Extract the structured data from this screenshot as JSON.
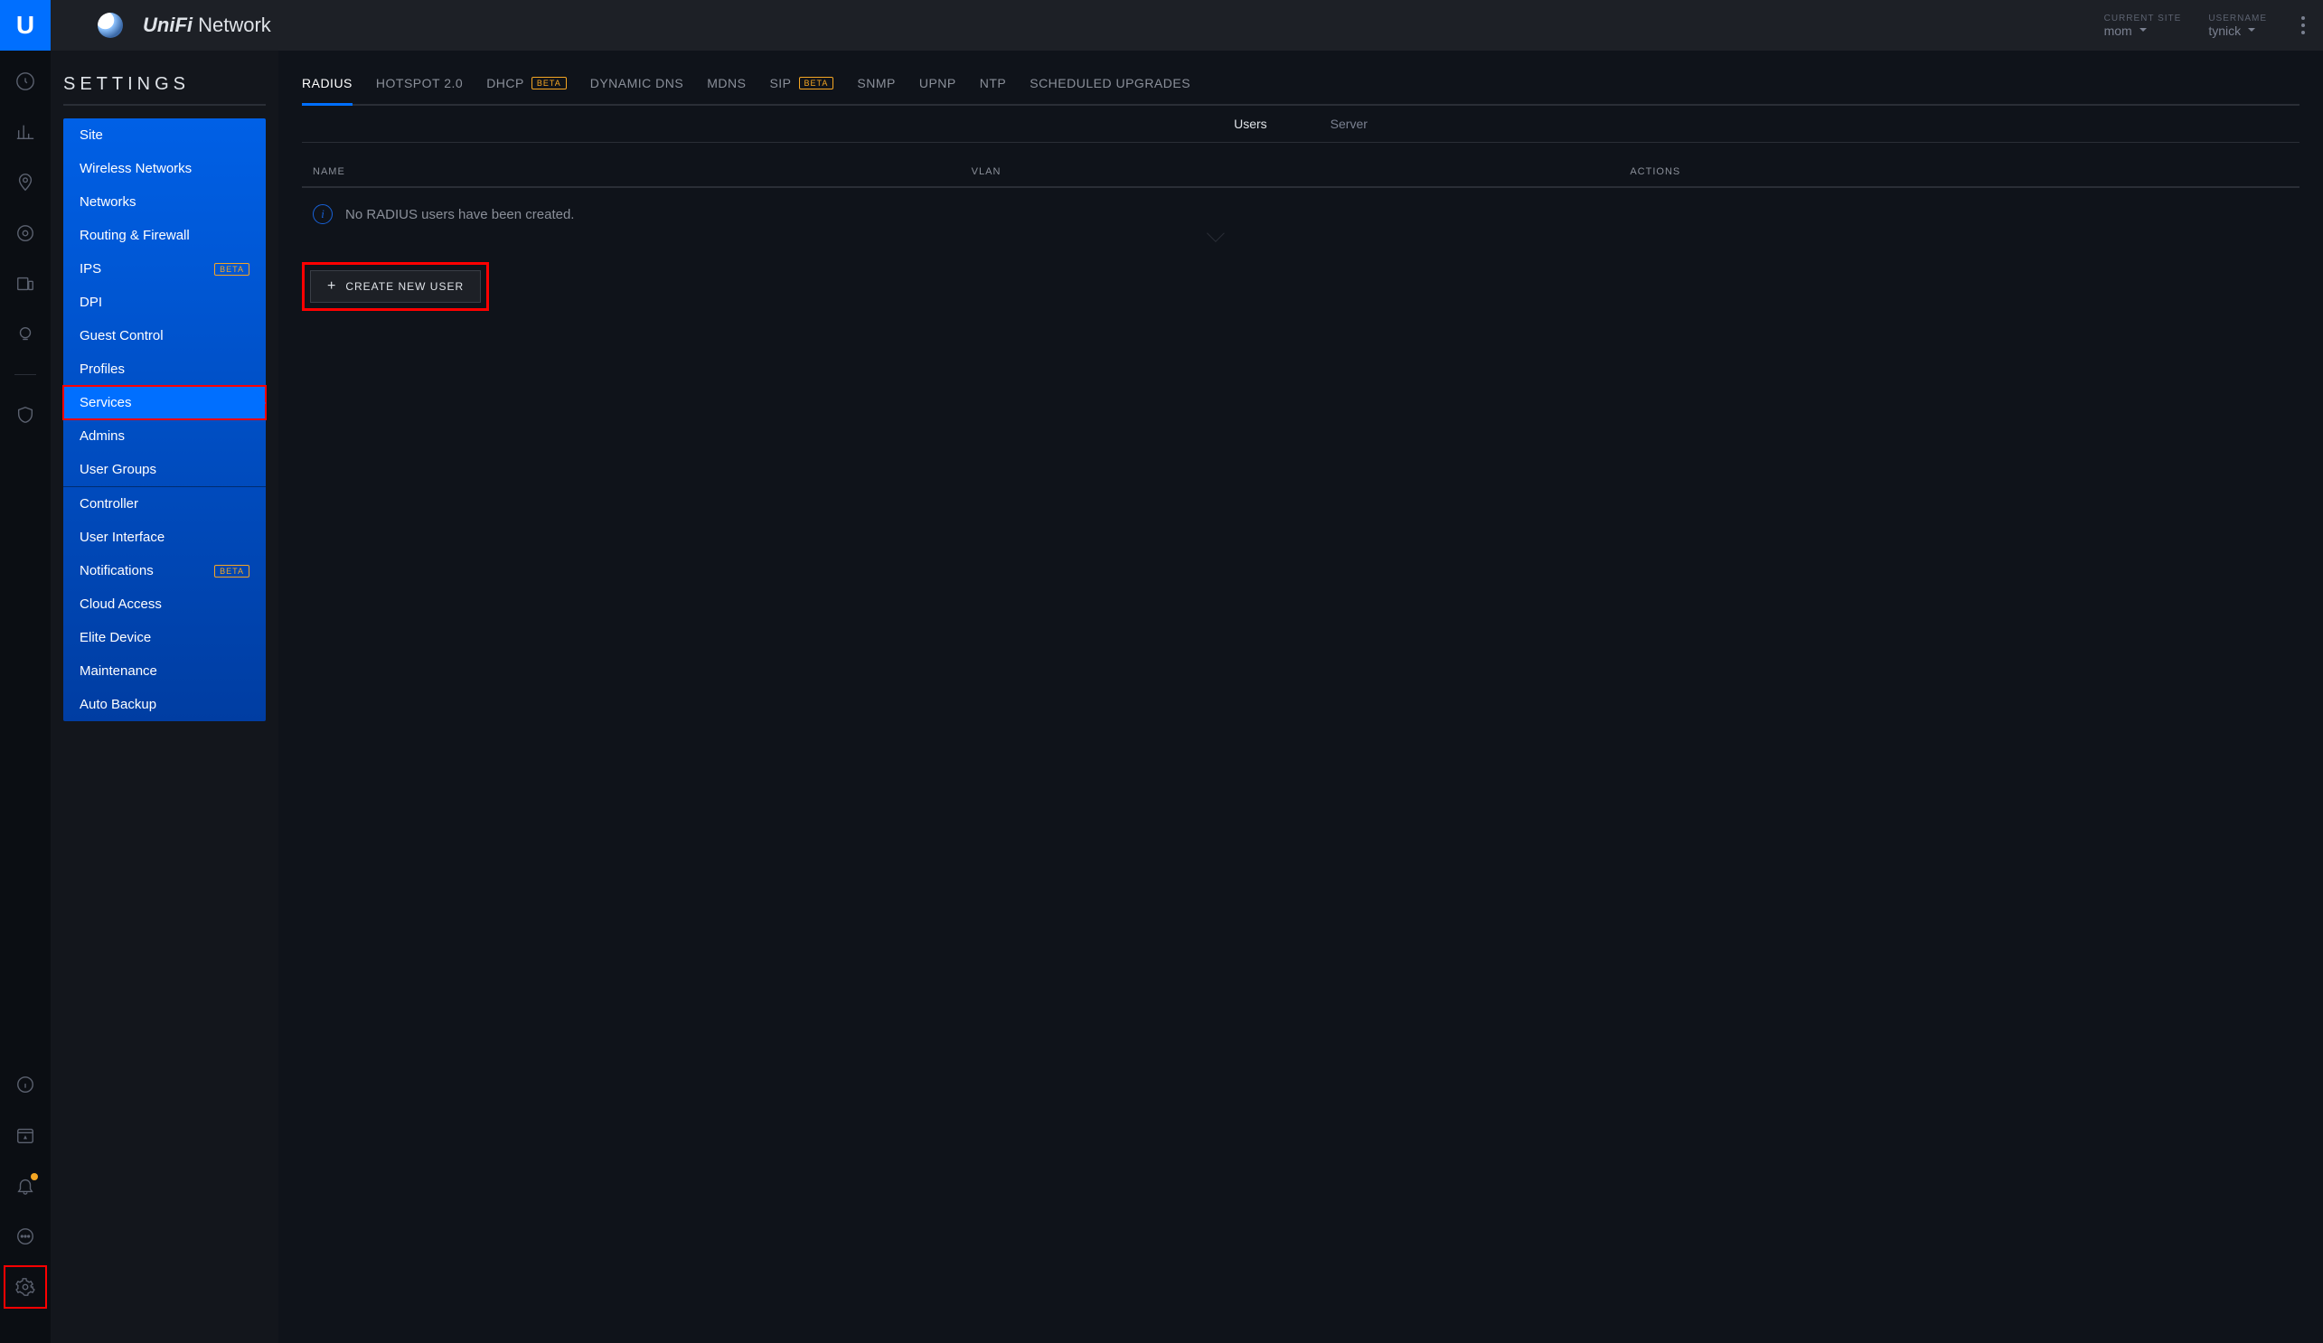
{
  "header": {
    "app_name": "UniFi",
    "app_suffix": "Network",
    "current_site_label": "CURRENT SITE",
    "current_site_value": "mom",
    "username_label": "USERNAME",
    "username_value": "tynick"
  },
  "settings": {
    "title": "SETTINGS",
    "menu_group1": [
      {
        "label": "Site",
        "badge": null,
        "active": false
      },
      {
        "label": "Wireless Networks",
        "badge": null,
        "active": false
      },
      {
        "label": "Networks",
        "badge": null,
        "active": false
      },
      {
        "label": "Routing & Firewall",
        "badge": null,
        "active": false
      },
      {
        "label": "IPS",
        "badge": "BETA",
        "active": false
      },
      {
        "label": "DPI",
        "badge": null,
        "active": false
      },
      {
        "label": "Guest Control",
        "badge": null,
        "active": false
      },
      {
        "label": "Profiles",
        "badge": null,
        "active": false
      },
      {
        "label": "Services",
        "badge": null,
        "active": true,
        "highlighted": true
      },
      {
        "label": "Admins",
        "badge": null,
        "active": false
      },
      {
        "label": "User Groups",
        "badge": null,
        "active": false
      }
    ],
    "menu_group2": [
      {
        "label": "Controller",
        "badge": null
      },
      {
        "label": "User Interface",
        "badge": null
      },
      {
        "label": "Notifications",
        "badge": "BETA"
      },
      {
        "label": "Cloud Access",
        "badge": null
      },
      {
        "label": "Elite Device",
        "badge": null
      },
      {
        "label": "Maintenance",
        "badge": null
      },
      {
        "label": "Auto Backup",
        "badge": null
      }
    ]
  },
  "tabs": [
    {
      "label": "RADIUS",
      "badge": null,
      "active": true
    },
    {
      "label": "HOTSPOT 2.0",
      "badge": null,
      "active": false
    },
    {
      "label": "DHCP",
      "badge": "BETA",
      "active": false
    },
    {
      "label": "DYNAMIC DNS",
      "badge": null,
      "active": false
    },
    {
      "label": "MDNS",
      "badge": null,
      "active": false
    },
    {
      "label": "SIP",
      "badge": "BETA",
      "active": false
    },
    {
      "label": "SNMP",
      "badge": null,
      "active": false
    },
    {
      "label": "UPNP",
      "badge": null,
      "active": false
    },
    {
      "label": "NTP",
      "badge": null,
      "active": false
    },
    {
      "label": "SCHEDULED UPGRADES",
      "badge": null,
      "active": false
    }
  ],
  "subtabs": {
    "users": "Users",
    "server": "Server"
  },
  "table": {
    "col_name": "NAME",
    "col_vlan": "VLAN",
    "col_actions": "ACTIONS",
    "empty_msg": "No RADIUS users have been created."
  },
  "create_button": "CREATE NEW USER"
}
